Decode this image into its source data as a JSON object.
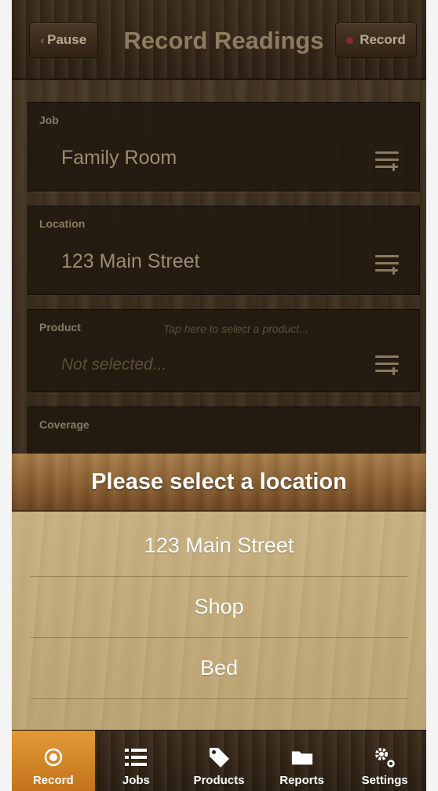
{
  "nav": {
    "pause_label": "Pause",
    "title": "Record Readings",
    "record_label": "Record"
  },
  "form": {
    "job": {
      "label": "Job",
      "value": "Family Room"
    },
    "location": {
      "label": "Location",
      "value": "123 Main Street"
    },
    "product": {
      "label": "Product",
      "hint": "Tap here to select a product...",
      "placeholder": "Not selected..."
    },
    "coverage": {
      "label": "Coverage"
    }
  },
  "picker": {
    "title": "Please select a location",
    "options": [
      "123 Main Street",
      "Shop",
      "Bed"
    ]
  },
  "tabs": [
    {
      "label": "Record",
      "icon": "record-icon",
      "active": true
    },
    {
      "label": "Jobs",
      "icon": "list-icon",
      "active": false
    },
    {
      "label": "Products",
      "icon": "tag-icon",
      "active": false
    },
    {
      "label": "Reports",
      "icon": "folder-icon",
      "active": false
    },
    {
      "label": "Settings",
      "icon": "gear-icon",
      "active": false
    }
  ],
  "colors": {
    "accent": "#d8882a",
    "wood_dark": "#2e2215",
    "sheet": "#c4ad7e"
  }
}
